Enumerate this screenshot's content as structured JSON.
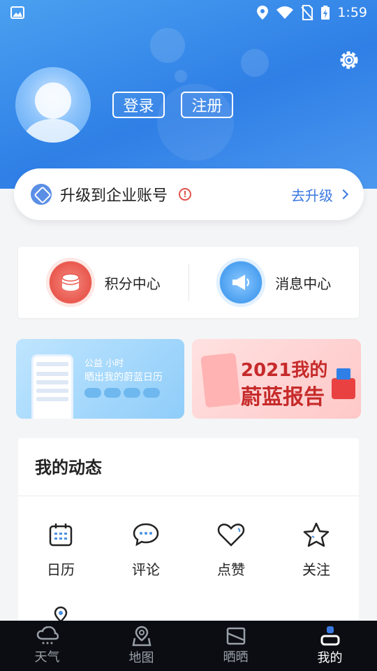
{
  "status_bar": {
    "time": "1:59"
  },
  "header": {
    "login_label": "登录",
    "register_label": "注册"
  },
  "upgrade": {
    "text": "升级到企业账号",
    "action": "去升级"
  },
  "centers": [
    {
      "label": "积分中心",
      "icon": "coins-icon"
    },
    {
      "label": "消息中心",
      "icon": "megaphone-icon"
    }
  ],
  "banners": {
    "left": {
      "line1": "公益 小时",
      "line2": "晒出我的蔚蓝日历"
    },
    "right": {
      "line1": "2021我的",
      "line2": "蔚蓝报告"
    }
  },
  "dynamics": {
    "title": "我的动态",
    "items": [
      {
        "label": "日历",
        "icon": "calendar-icon"
      },
      {
        "label": "评论",
        "icon": "comment-icon"
      },
      {
        "label": "点赞",
        "icon": "heart-icon"
      },
      {
        "label": "关注",
        "icon": "star-icon"
      }
    ]
  },
  "tabs": [
    {
      "label": "天气",
      "icon": "weather-icon",
      "active": false
    },
    {
      "label": "地图",
      "icon": "map-icon",
      "active": false
    },
    {
      "label": "晒晒",
      "icon": "photo-icon",
      "active": false
    },
    {
      "label": "我的",
      "icon": "profile-icon",
      "active": true
    }
  ],
  "colors": {
    "primary": "#2f7fe6",
    "warning": "#e3524a",
    "tabbar": "#0b0d12"
  }
}
